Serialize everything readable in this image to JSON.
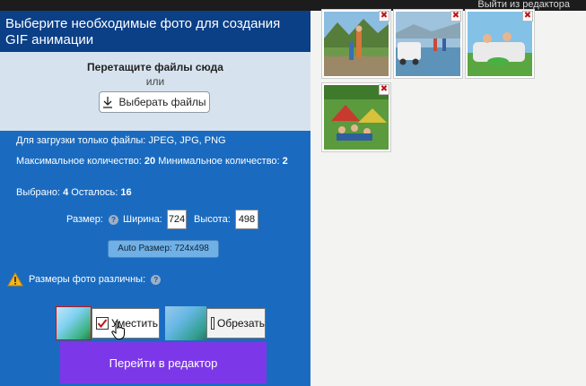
{
  "topbar": {
    "exit_label": "Выйти из редактора"
  },
  "panel": {
    "title": "Выберите необходимые фото для создания GIF анимации",
    "drop_title": "Перетащите файлы сюда",
    "drop_or": "или",
    "pick_button": "Выберать файлы",
    "file_types": "Для загрузки только файлы: JPEG, JPG, PNG",
    "max_label": "Максимальное количество:",
    "max_value": "20",
    "min_label": "Минимальное количество:",
    "min_value": "2",
    "selected_label": "Выбрано:",
    "selected_value": "4",
    "remaining_label": "Осталось:",
    "remaining_value": "16",
    "size_label": "Размер:",
    "width_label": "Ширина:",
    "width_value": "724",
    "height_label": "Высота:",
    "height_value": "498",
    "auto_size_button": "Auto Размер: 724x498",
    "warning_text": "Размеры фото различны:",
    "fit_option": {
      "label": "Уместить",
      "checked": true
    },
    "crop_option": {
      "label": "Обрезать",
      "checked": false
    },
    "go_button": "Перейти в редактор"
  },
  "icons": {
    "download": "download-arrow-icon",
    "help": "question-icon",
    "warning": "warning-triangle-icon",
    "close": "close-x-icon",
    "cursor": "hand-pointer-icon"
  },
  "colors": {
    "panel_bg": "#1a6bc0",
    "title_bg": "#0b3f86",
    "drop_bg": "#d6e3ef",
    "go_button_bg": "#7c38e8",
    "auto_button_bg": "#6fb0e6",
    "close_red": "#c0151a"
  },
  "thumbnails": [
    {
      "close_glyph": "✖"
    },
    {
      "close_glyph": "✖"
    },
    {
      "close_glyph": "✖"
    },
    {
      "close_glyph": "✖"
    }
  ]
}
